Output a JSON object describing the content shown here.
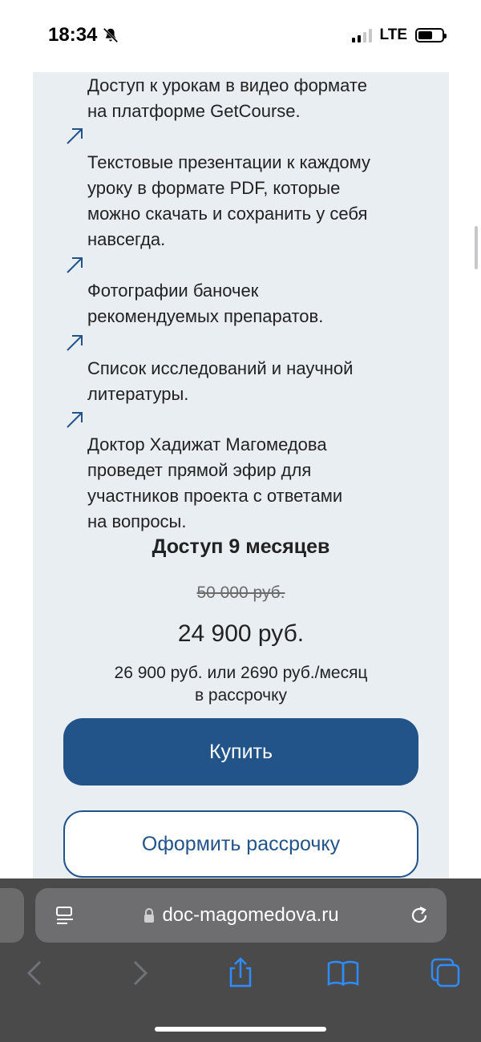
{
  "status_bar": {
    "time": "18:34",
    "network": "LTE",
    "icons": [
      "bell-slash-icon",
      "signal-icon",
      "battery-icon"
    ]
  },
  "features": [
    "Доступ к урокам в видео формате\nна платформе GetCourse.",
    "Текстовые презентации к каждому\nуроку в формате PDF, которые\nможно скачать и сохранить у себя\nнавсегда.",
    "Фотографии баночек\nрекомендуемых препаратов.",
    "Список исследований и научной\nлитературы.",
    "Доктор Хадижат Магомедова\nпроведет прямой эфир для\nучастников проекта с ответами\nна вопросы."
  ],
  "pricing": {
    "access_title": "Доступ 9 месяцев",
    "old_price": "50 000 руб.",
    "new_price": "24 900 руб.",
    "installment_text": "26 900 руб. или 2690 руб./месяц\nв рассрочку",
    "buy_label": "Купить",
    "installment_label": "Оформить рассрочку"
  },
  "browser": {
    "url": "doc-magomedova.ru"
  },
  "colors": {
    "accent": "#22548a",
    "content_bg": "#e9eef3",
    "browser_bg": "#4a4a4b"
  }
}
